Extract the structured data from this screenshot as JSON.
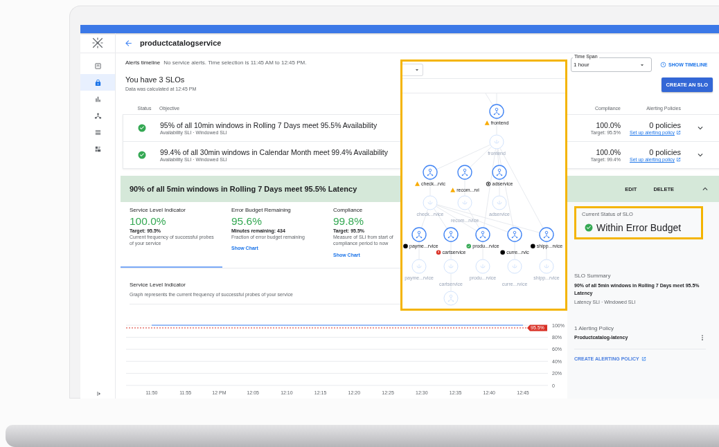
{
  "header": {
    "title": "productcatalogservice"
  },
  "sidebar": {
    "items": [
      {
        "kind": "dashboard",
        "selected": false
      },
      {
        "kind": "lock",
        "selected": true
      },
      {
        "kind": "bar-chart",
        "selected": false
      },
      {
        "kind": "topology",
        "selected": false
      },
      {
        "kind": "list",
        "selected": false
      },
      {
        "kind": "widgets",
        "selected": false
      }
    ]
  },
  "alerts": {
    "label": "Alerts timeline",
    "message": "No service alerts. Time selection is 11:45 AM to 12:45 PM."
  },
  "summary": {
    "title": "You have 3 SLOs",
    "note": "Data was calculated at 12:45 PM"
  },
  "time_span": {
    "label": "Time Span",
    "value": "1 hour"
  },
  "show_timeline": "SHOW TIMELINE",
  "create_button": "CREATE AN SLO",
  "table": {
    "columns": [
      "Status",
      "Objective",
      "Compliance",
      "Alerting Policies"
    ],
    "rows": [
      {
        "healthy": true,
        "objective": "95% of all 10min windows in Rolling 7 Days meet 95.5% Availability",
        "sli": "Availability SLI · Windowed SLI",
        "compliance": "100.0%",
        "target": "Target: 95.5%",
        "policies": "0 policies",
        "policy_link": "Set up alerting policy",
        "expanded": false
      },
      {
        "healthy": true,
        "objective": "99.4% of all 30min windows in Calendar Month meet 99.4% Availability",
        "sli": "Availability SLI · Windowed SLI",
        "compliance": "100.0%",
        "target": "Target: 99.4%",
        "policies": "0 policies",
        "policy_link": "Set up alerting policy",
        "expanded": false
      }
    ]
  },
  "expanded_slo": {
    "title": "90% of all 5min windows in Rolling 7 Days meet 95.5% Latency",
    "actions": [
      "EDIT",
      "DELETE"
    ],
    "expanded": true,
    "tiles": [
      {
        "title": "Service Level Indicator",
        "value": "100.0%",
        "detail": "Target: 95.5%",
        "description": "Current frequency of successful probes of your service",
        "selected": true
      },
      {
        "title": "Error Budget Remaining",
        "value": "95.6%",
        "detail": "Minutes remaining: 434",
        "description": "Fraction of error budget remaining",
        "link": "Show Chart",
        "selected": false
      },
      {
        "title": "Compliance",
        "value": "99.8%",
        "detail": "Target: 95.5%",
        "description": "Measure of SLI from start of compliance period to now",
        "link": "Show Chart",
        "selected": false
      }
    ],
    "sli_panel": {
      "title": "Service Level Indicator",
      "description": "Graph represents the current frequency of successful probes of your service",
      "chart_data": {
        "type": "line",
        "categories": [
          "11:50",
          "11:55",
          "12 PM",
          "12:05",
          "12:10",
          "12:15",
          "12:20",
          "12:25",
          "12:30",
          "12:35",
          "12:40",
          "12:45"
        ],
        "series": [
          {
            "color": "#7baaf7",
            "values": [
              100,
              100,
              100,
              100,
              100,
              100,
              100,
              100,
              100,
              100,
              100,
              100
            ]
          }
        ],
        "grid": true,
        "ylim": [
          0,
          100
        ],
        "yticks": [
          {
            "value": 0,
            "label": "0"
          },
          {
            "value": 20,
            "label": "20%"
          },
          {
            "value": 40,
            "label": "40%"
          },
          {
            "value": 60,
            "label": "60%"
          },
          {
            "value": 80,
            "label": "80%"
          },
          {
            "value": 100,
            "label": "100%"
          }
        ],
        "ref_lines": [
          {
            "axis": "y",
            "value": 95.5,
            "label": "95.5%",
            "color": "#d93025"
          }
        ]
      }
    },
    "status_panel": {
      "label": "Current Status of SLO",
      "healthy": true,
      "text": "Within Error Budget"
    },
    "slo_summary": {
      "title": "SLO Summary",
      "text": "90% of all 5min windows in Rolling 7 Days meet 95.5% Latency",
      "sli": "Latency SLI · Windowed SLI"
    },
    "alerting": {
      "title": "1 Alerting Policy",
      "policies": [
        "Productcatalog-latency"
      ],
      "create_link": "CREATE ALERTING POLICY"
    }
  },
  "service_graph": {
    "layers": [
      [
        {
          "kind": "warning",
          "label": "frontend"
        }
      ],
      [
        {
          "kind": "endpoint",
          "label": "frontend"
        }
      ],
      [
        {
          "kind": "warning",
          "label": "check...rvic"
        },
        {
          "kind": "warning",
          "label": "recom...rvi"
        },
        {
          "kind": "info",
          "label": "adservice"
        }
      ],
      [
        {
          "kind": "endpoint",
          "label": "check...rvice"
        },
        {
          "kind": "endpoint",
          "label": "recom...rvice"
        },
        {
          "kind": "endpoint",
          "label": "adservice"
        }
      ],
      [
        {
          "kind": "nodata",
          "label": "payme...rvice"
        },
        {
          "kind": "error",
          "label": "cartservice"
        },
        {
          "kind": "ok",
          "label": "produ...rvice"
        },
        {
          "kind": "nodata",
          "label": "curre...rvic"
        },
        {
          "kind": "nodata",
          "label": "shipp...rvice"
        }
      ],
      [
        {
          "kind": "endpoint",
          "label": "payme...rvice"
        },
        {
          "kind": "endpoint",
          "label": "cartservice"
        },
        {
          "kind": "endpoint",
          "label": "produ...rvice"
        },
        {
          "kind": "endpoint",
          "label": "curre...rvice"
        },
        {
          "kind": "endpoint",
          "label": "shipp...rvice"
        }
      ],
      [
        {
          "kind": "faded"
        }
      ]
    ]
  }
}
